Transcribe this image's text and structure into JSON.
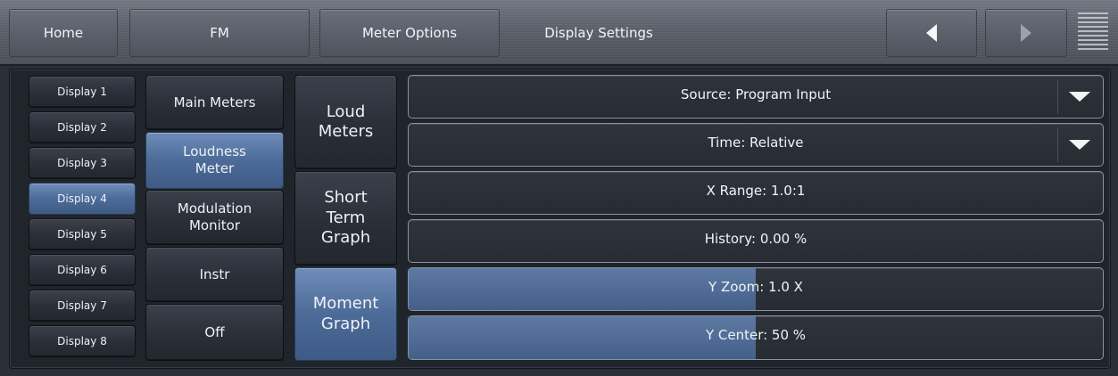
{
  "nav": {
    "home_label": "Home",
    "fm_label": "FM",
    "meter_options_label": "Meter Options",
    "display_settings_label": "Display Settings",
    "back_icon": "triangle-left-icon",
    "forward_icon": "triangle-right-icon",
    "menu_icon": "hamburger-menu-icon"
  },
  "displays": [
    {
      "label": "Display 1"
    },
    {
      "label": "Display 2"
    },
    {
      "label": "Display 3"
    },
    {
      "label": "Display 4",
      "selected": true
    },
    {
      "label": "Display 5"
    },
    {
      "label": "Display 6"
    },
    {
      "label": "Display 7"
    },
    {
      "label": "Display 8"
    }
  ],
  "modes": [
    {
      "label": "Main Meters"
    },
    {
      "label": "Loudness\nMeter",
      "selected": true
    },
    {
      "label": "Modulation\nMonitor"
    },
    {
      "label": "Instr"
    },
    {
      "label": "Off"
    }
  ],
  "submodes": [
    {
      "label": "Loud\nMeters"
    },
    {
      "label": "Short\nTerm\nGraph"
    },
    {
      "label": "Moment\nGraph",
      "selected": true
    }
  ],
  "controls": {
    "source": {
      "label": "Source: Program Input",
      "type": "dropdown"
    },
    "time": {
      "label": "Time: Relative",
      "type": "dropdown"
    },
    "x_range": {
      "label": "X Range: 1.0:1",
      "level": 0
    },
    "history": {
      "label": "History: 0.00 %",
      "level": 0
    },
    "y_zoom": {
      "label": "Y Zoom: 1.0 X",
      "level": 0.5
    },
    "y_center": {
      "label": "Y Center: 50 %",
      "level": 0.5
    }
  },
  "colors": {
    "accent_blue": "#4d6b98",
    "panel_bg": "#20242b",
    "topbar_bg": "#5a6069"
  }
}
